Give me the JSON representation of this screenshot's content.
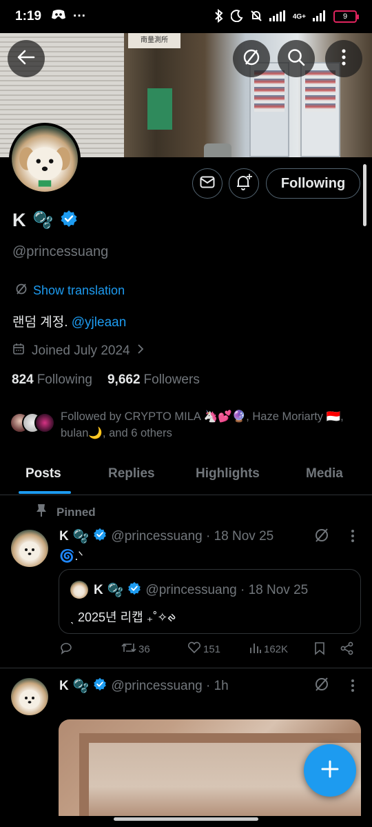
{
  "status_bar": {
    "time": "1:19",
    "left_extra": "···",
    "network": "4G+",
    "battery": "9"
  },
  "banner": {
    "sign_text": "南量測所"
  },
  "profile": {
    "name": "K",
    "name_emoji": "🫧",
    "handle": "@princessuang",
    "show_translation": "Show translation",
    "bio_text": "랜덤 계정.",
    "bio_mention": "@yjleaan",
    "joined": "Joined July 2024",
    "following_count": "824",
    "following_label": "Following",
    "followers_count": "9,662",
    "followers_label": "Followers",
    "followed_by": "Followed by CRYPTO MILA 🦄💕🔮, Haze Moriarty 🇮🇩, bulan🌙, and 6 others",
    "following_button": "Following"
  },
  "tabs": [
    {
      "label": "Posts",
      "active": true
    },
    {
      "label": "Replies",
      "active": false
    },
    {
      "label": "Highlights",
      "active": false
    },
    {
      "label": "Media",
      "active": false
    }
  ],
  "posts": [
    {
      "pinned_label": "Pinned",
      "name": "K",
      "emoji": "🫧",
      "handle_time": "@princessuang · 18 Nov 25",
      "text": "🌀.ᐠ",
      "quote": {
        "name": "K",
        "emoji": "🫧",
        "handle_time": "@princessuang · 18 Nov 25",
        "text": "ˎ 2025년 리캡 ₊˚✧ᰊ"
      },
      "retweets": "36",
      "likes": "151",
      "views": "162K"
    },
    {
      "name": "K",
      "emoji": "🫧",
      "handle_time": "@princessuang · 1h"
    }
  ],
  "colors": {
    "accent": "#1d9bf0",
    "text_primary": "#e7e9ea",
    "text_secondary": "#71767b",
    "border": "#2f3336"
  },
  "icons": [
    "back-arrow-icon",
    "translate-icon",
    "search-icon",
    "more-icon",
    "message-icon",
    "bell-plus-icon",
    "verified-icon",
    "calendar-icon",
    "chevron-right-icon",
    "pin-icon",
    "reply-icon",
    "retweet-icon",
    "like-icon",
    "views-icon",
    "bookmark-icon",
    "share-icon",
    "plus-icon"
  ]
}
